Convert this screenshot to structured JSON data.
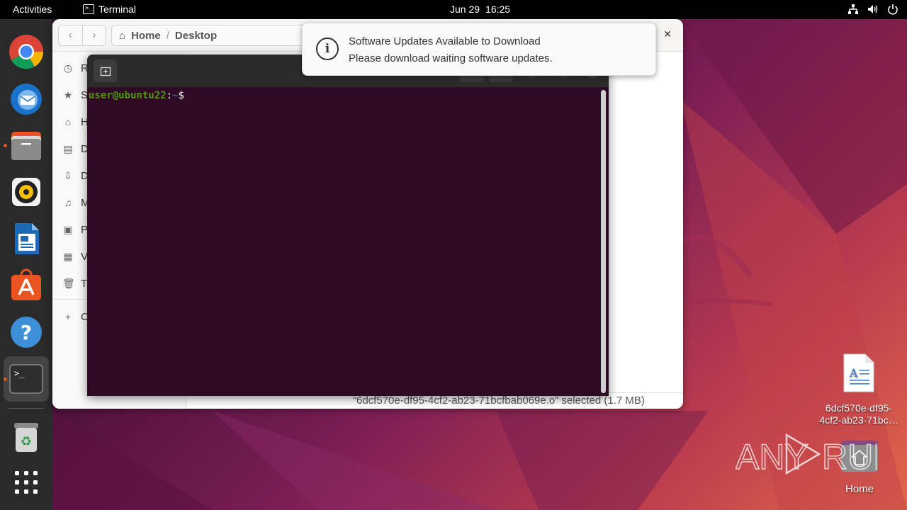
{
  "topbar": {
    "activities": "Activities",
    "app_name": "Terminal",
    "date": "Jun 29",
    "time": "16:25",
    "tray_icons": [
      "network-icon",
      "volume-icon",
      "power-icon"
    ]
  },
  "dock": {
    "items": [
      {
        "name": "chrome",
        "running": false
      },
      {
        "name": "thunderbird",
        "running": false
      },
      {
        "name": "files",
        "running": true
      },
      {
        "name": "rhythmbox",
        "running": false
      },
      {
        "name": "libreoffice-writer",
        "running": false
      },
      {
        "name": "ubuntu-software",
        "running": false
      },
      {
        "name": "help",
        "running": false
      },
      {
        "name": "terminal",
        "running": true,
        "active": true
      },
      {
        "name": "trash",
        "running": false
      },
      {
        "name": "show-apps",
        "running": false
      }
    ]
  },
  "files_window": {
    "path": [
      "Home",
      "Desktop"
    ],
    "sidebar": [
      {
        "icon": "recent-icon",
        "label": "R"
      },
      {
        "icon": "star-icon",
        "label": "S"
      },
      {
        "icon": "home-icon",
        "label": "H"
      },
      {
        "icon": "document-icon",
        "label": "D"
      },
      {
        "icon": "download-icon",
        "label": "D"
      },
      {
        "icon": "music-icon",
        "label": "M"
      },
      {
        "icon": "picture-icon",
        "label": "Pi"
      },
      {
        "icon": "video-icon",
        "label": "V"
      },
      {
        "icon": "trash-icon",
        "label": "Tr"
      },
      {
        "icon": "plus-icon",
        "label": "O"
      }
    ],
    "status": "“6dcf570e-df95-4cf2-ab23-71bcfbab069e.o” selected (1.7 MB)"
  },
  "terminal": {
    "prompt_user": "user@ubuntu22",
    "prompt_colon": ":",
    "prompt_path": "~",
    "prompt_symbol": "$"
  },
  "notification": {
    "title": "Software Updates Available to Download",
    "body": "Please download waiting software updates."
  },
  "desktop": {
    "file_label_line1": "6dcf570e-df95-",
    "file_label_line2": "4cf2-ab23-71bc…",
    "home_label": "Home"
  },
  "watermark": "ANY RUN",
  "colors": {
    "topbar": "#000000",
    "dock": "#2a2a2a",
    "terminal_bg": "#300a24",
    "accent": "#e95420"
  }
}
